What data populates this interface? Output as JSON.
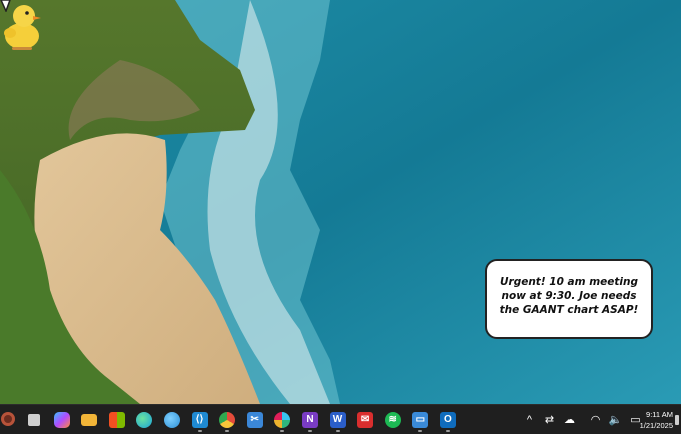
{
  "desktop": {
    "wallpaper": "aerial-beach-cliff-ocean",
    "sticky_bubble": {
      "text": "Urgent! 10 am meeting now at 9:30. Joe needs the GAANT chart ASAP!"
    },
    "mascot": "yellow-duck"
  },
  "taskbar": {
    "weather_icon": "weather-icon",
    "apps": [
      {
        "name": "file-explorer-icon",
        "color": "#f0c23a",
        "glyph": ""
      },
      {
        "name": "copilot-icon",
        "color": "#6b7bff",
        "glyph": ""
      },
      {
        "name": "folder-icon",
        "color": "#f2b538",
        "glyph": ""
      },
      {
        "name": "store-icon",
        "color": "#e9e9e9",
        "glyph": ""
      },
      {
        "name": "edge-icon",
        "color": "#1aa2d8",
        "glyph": ""
      },
      {
        "name": "edge-canary-icon",
        "color": "#2c8fd6",
        "glyph": ""
      },
      {
        "name": "vscode-icon",
        "color": "#1f8ad2",
        "glyph": ""
      },
      {
        "name": "chrome-icon",
        "color": "#e44b3a",
        "glyph": ""
      },
      {
        "name": "snip-icon",
        "color": "#3b87d8",
        "glyph": ""
      },
      {
        "name": "slack-icon",
        "color": "#e01e5a",
        "glyph": ""
      },
      {
        "name": "onenote-icon",
        "color": "#7a3cc4",
        "glyph": "N"
      },
      {
        "name": "word-icon",
        "color": "#2b5ec9",
        "glyph": "W"
      },
      {
        "name": "mail-icon",
        "color": "#d92e2e",
        "glyph": ""
      },
      {
        "name": "spotify-icon",
        "color": "#1db954",
        "glyph": ""
      },
      {
        "name": "remote-desktop-icon",
        "color": "#3a8ad8",
        "glyph": ""
      },
      {
        "name": "outlook-icon",
        "color": "#0f6cbd",
        "glyph": "O"
      }
    ],
    "tray": {
      "chevron": "^",
      "time": "9:11 AM",
      "date": "1/21/2025"
    }
  }
}
